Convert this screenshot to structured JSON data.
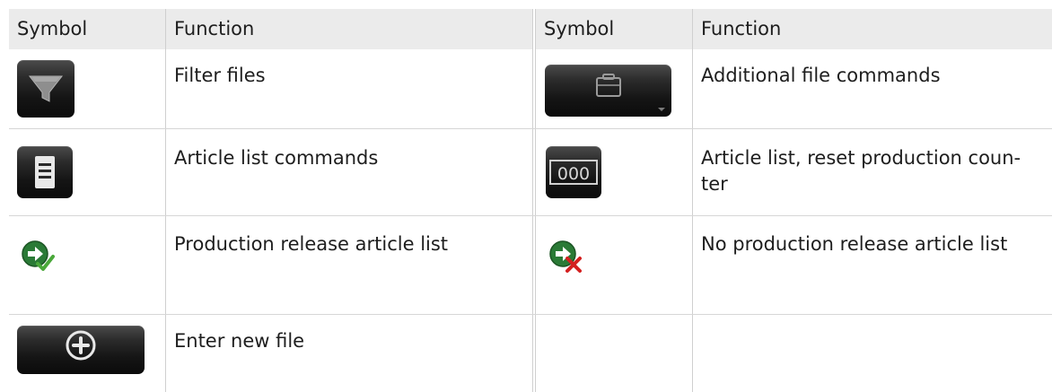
{
  "table": {
    "headers": {
      "symbol_left": "Symbol",
      "function_left": "Function",
      "symbol_right": "Symbol",
      "function_right": "Function"
    },
    "rows": [
      {
        "left_icon": "filter-icon",
        "left_function": "Filter files",
        "right_icon": "briefcase-icon",
        "right_function": "Additional file commands"
      },
      {
        "left_icon": "document-list-icon",
        "left_function": "Article list commands",
        "right_icon": "counter-reset-icon",
        "right_function": "Article list, reset production coun-ter"
      },
      {
        "left_icon": "arrow-check-icon",
        "left_function": "Production release article list",
        "right_icon": "arrow-cross-icon",
        "right_function": "No production release article list"
      },
      {
        "left_icon": "plus-circle-icon",
        "left_function": "Enter new file",
        "right_icon": "",
        "right_function": ""
      }
    ],
    "counter_digits": "000"
  },
  "colors": {
    "header_bg": "#ebebeb",
    "button_dark": "#111111",
    "check_green": "#4aa83a",
    "cross_red": "#d42020",
    "arrow_green": "#1f6a2a"
  }
}
